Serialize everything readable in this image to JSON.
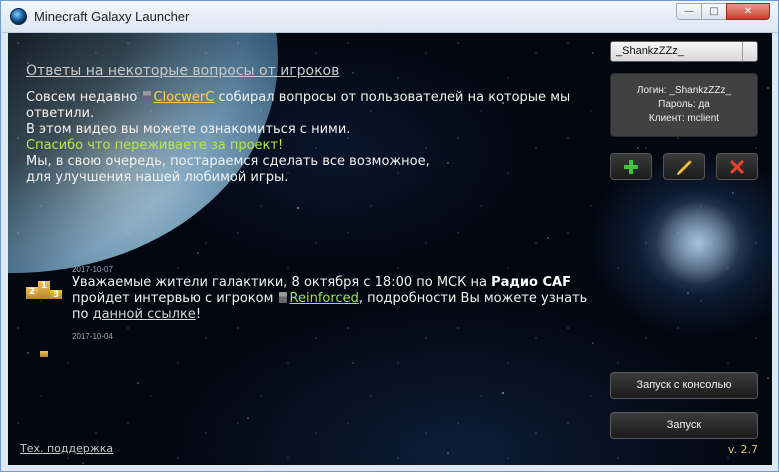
{
  "window": {
    "title": "Minecraft Galaxy Launcher",
    "minimize_glyph": "—",
    "maximize_glyph": "□",
    "close_glyph": "✕"
  },
  "news": {
    "heading": "Ответы на некоторые вопросы от игроков",
    "line1_prefix": "Совсем недавно",
    "line1_user": "ClocwerC",
    "line1_suffix": "собирал вопросы от пользователей на которые мы ответили.",
    "line2": "В этом видео вы можете ознакомиться с ними.",
    "thanks": "Спасибо что переживаете за проект!",
    "closing1": "Мы, в свою очередь, постараемся сделать все возможное,",
    "closing2": "для улучшения нашей любимой игры."
  },
  "feed": [
    {
      "date": "2017-10-07",
      "text_prefix": "Уважаемые жители галактики, 8 октября с 18:00 по МСК на",
      "radio": "Радио CAF",
      "text_mid": "пройдет интервью с игроком",
      "user": "Reinforced",
      "text_after_user": ", подробности Вы можете узнать по",
      "link": "данной ссылке",
      "text_end": "!",
      "podium": [
        "2",
        "1",
        "3"
      ]
    },
    {
      "date": "2017-10-04"
    }
  ],
  "footer": {
    "support": "Тех. поддержка",
    "version": "v. 2.7"
  },
  "account": {
    "selected": "_ShankzZZz_",
    "login_line": "Логин: _ShankzZZz_",
    "password_line": "Пароль: да",
    "client_line": "Клиент: mclient"
  },
  "buttons": {
    "launch_console": "Запуск с консолью",
    "launch": "Запуск"
  },
  "colors": {
    "add": "#3ec43e",
    "edit": "#f0c23a",
    "delete": "#e0412c"
  },
  "icons": {
    "add": "plus-icon",
    "edit": "pencil-icon",
    "delete": "x-icon"
  }
}
